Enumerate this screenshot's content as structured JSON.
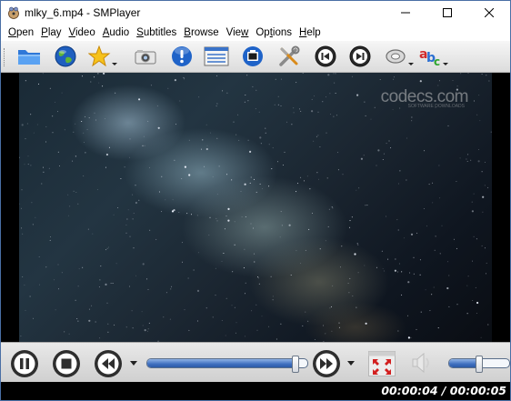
{
  "window": {
    "title": "mlky_6.mp4 - SMPlayer"
  },
  "menu": {
    "items": [
      {
        "accel": "O",
        "rest": "pen"
      },
      {
        "accel": "P",
        "rest": "lay"
      },
      {
        "accel": "V",
        "rest": "ideo"
      },
      {
        "accel": "A",
        "rest": "udio"
      },
      {
        "accel": "S",
        "rest": "ubtitles"
      },
      {
        "accel": "B",
        "rest": "rowse"
      },
      {
        "prefix": "Vie",
        "accel": "w",
        "rest": ""
      },
      {
        "prefix": "Op",
        "accel": "t",
        "rest": "ions"
      },
      {
        "accel": "H",
        "rest": "elp"
      }
    ]
  },
  "toolbar": {
    "buttons": [
      "open-folder-icon",
      "globe-icon",
      "favorites-star-icon",
      "screenshot-camera-icon",
      "info-icon",
      "playlist-icon",
      "video-equalizer-icon",
      "preferences-tools-icon",
      "previous-chapter-icon",
      "next-chapter-icon",
      "audio-track-icon",
      "subtitles-icon"
    ]
  },
  "video": {
    "watermark": "codecs.com",
    "watermark_sub": "SOFTWARE DOWNLOADS"
  },
  "controls": {
    "seek_progress": 0.93,
    "volume_level": 0.52
  },
  "status": {
    "time": "00:00:04 / 00:00:05"
  },
  "colors": {
    "accent": "#3f6fbf",
    "window_border": "#4a6fa5"
  }
}
